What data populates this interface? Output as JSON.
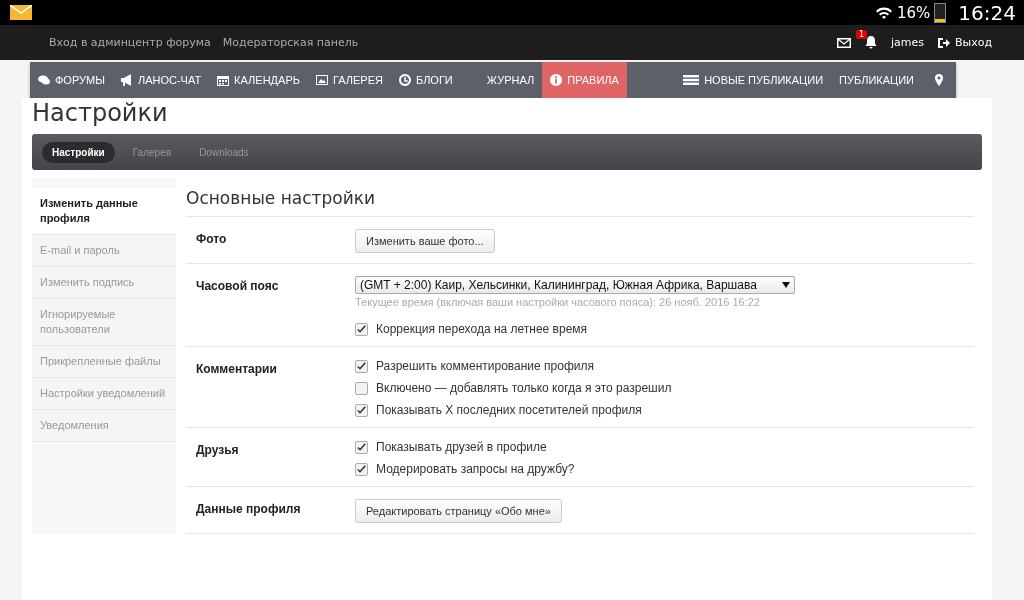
{
  "status_bar": {
    "battery": {
      "text": "16%",
      "level": 0.16
    },
    "time": "16:24"
  },
  "top_bar": {
    "links": [
      "Вход в админцентр форума",
      "Модераторская панель"
    ],
    "alert_count": "1",
    "user": "james",
    "logout": "Выход"
  },
  "nav": {
    "items": [
      {
        "label": "ФОРУМЫ",
        "selected": false
      },
      {
        "label": "ЛАНОС-ЧАТ",
        "selected": false
      },
      {
        "label": "КАЛЕНДАРЬ",
        "selected": false
      },
      {
        "label": "ГАЛЕРЕЯ",
        "selected": false
      },
      {
        "label": "БЛОГИ",
        "selected": false
      },
      {
        "label": "ЖУРНАЛ",
        "selected": false
      },
      {
        "label": "ПРАВИЛА",
        "selected": true
      },
      {
        "label": "НОВЫЕ ПУБЛИКАЦИИ",
        "selected": false
      },
      {
        "label": "ПУБЛИКАЦИИ",
        "selected": false
      }
    ]
  },
  "page_title": "Настройки",
  "tabs": [
    {
      "label": "Настройки",
      "selected": true
    },
    {
      "label": "Галерея",
      "selected": false
    },
    {
      "label": "Downloads",
      "selected": false
    }
  ],
  "sidebar": {
    "items": [
      {
        "label": "Изменить данные профиля",
        "selected": true
      },
      {
        "label": "E-mail и пароль",
        "selected": false
      },
      {
        "label": "Изменить подпись",
        "selected": false
      },
      {
        "label": "Игнорируемые пользователи",
        "selected": false
      },
      {
        "label": "Прикрепленные файлы",
        "selected": false
      },
      {
        "label": "Настройки уведомлений",
        "selected": false
      },
      {
        "label": "Уведомления",
        "selected": false
      }
    ]
  },
  "main": {
    "heading": "Основные настройки",
    "sections": [
      {
        "label": "Фото",
        "controls": [
          {
            "kind": "button",
            "text": "Изменить ваше фото..."
          }
        ]
      },
      {
        "label": "Часовой пояс",
        "controls": [
          {
            "kind": "select",
            "text": "(GMT + 2:00) Каир, Хельсинки, Калининград, Южная Африка, Варшава"
          },
          {
            "kind": "hint",
            "text": "Текущее время (включая ваши настройки часового пояса): 26 нояб. 2016 16:22"
          },
          {
            "kind": "checkbox",
            "text": "Коррекция перехода на летнее время",
            "checked": true
          }
        ]
      },
      {
        "label": "Комментарии",
        "controls": [
          {
            "kind": "checkbox",
            "text": "Разрешить комментирование профиля",
            "checked": true
          },
          {
            "kind": "checkbox",
            "text": "Включено — добавлять только когда я это разрешил",
            "checked": false
          },
          {
            "kind": "checkbox",
            "text": "Показывать X последних посетителей профиля",
            "checked": true
          }
        ]
      },
      {
        "label": "Друзья",
        "controls": [
          {
            "kind": "checkbox",
            "text": "Показывать друзей в профиле",
            "checked": true
          },
          {
            "kind": "checkbox",
            "text": "Модерировать запросы на дружбу?",
            "checked": true
          }
        ]
      },
      {
        "label": "Данные профиля",
        "controls": [
          {
            "kind": "button",
            "text": "Редактировать страницу «Обо мне»"
          }
        ]
      }
    ]
  }
}
